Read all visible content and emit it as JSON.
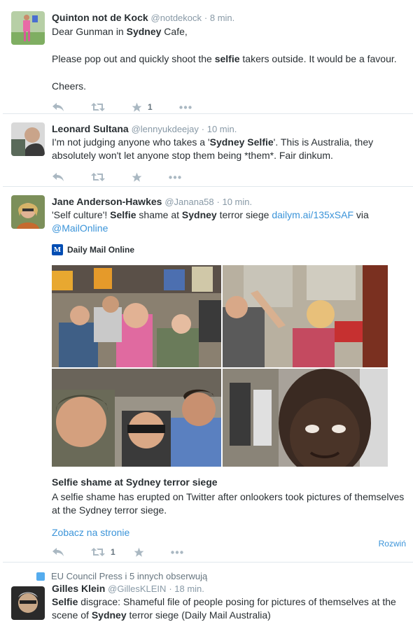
{
  "tweets": [
    {
      "fullname": "Quinton not de Kock",
      "handle": "@notdekock",
      "time": "· 8 min.",
      "p1_a": "Dear Gunman in ",
      "p1_b": "Sydney",
      "p1_c": " Cafe,",
      "p2_a": "Please pop out and quickly shoot the ",
      "p2_b": "selfie",
      "p2_c": " takers outside. It would be a favour.",
      "p3": "Cheers.",
      "fav_count": "1"
    },
    {
      "fullname": "Leonard Sultana",
      "handle": "@lennyukdeejay",
      "time": "· 10 min.",
      "t_a": "I'm not judging anyone who takes a '",
      "t_b": "Sydney Selfie",
      "t_c": "'. This is Australia, they absolutely won't let anyone stop them being *them*. Fair dinkum."
    },
    {
      "fullname": "Jane Anderson-Hawkes",
      "handle": "@Janana58",
      "time": "· 10 min.",
      "t_a": "'Self culture'! ",
      "t_b": "Selfie",
      "t_c": " shame at ",
      "t_d": "Sydney",
      "t_e": " terror siege ",
      "t_link": "dailym.ai/135xSAF",
      "t_via": " via",
      "t_mention": "@MailOnline",
      "card_logo": "M",
      "card_source": "Daily Mail Online",
      "card_title": "Selfie shame at Sydney terror siege",
      "card_desc": "A selfie shame has erupted on Twitter after onlookers took pictures of themselves at the Sydney terror siege.",
      "view_on": "Zobacz na stronie",
      "retweet_count": "1",
      "expand": "Rozwiń"
    },
    {
      "context": "EU Council Press i 5 innych obserwują",
      "fullname": "Gilles Klein",
      "handle": "@GillesKLEIN",
      "time": "· 18 min.",
      "l1_a": "Selfie",
      "l1_b": " disgrace: Shameful file of people posing for pictures of themselves at the",
      "l2_a": "scene of ",
      "l2_b": "Sydney",
      "l2_c": " terror siege (Daily Mail Australia)"
    }
  ],
  "colors": {
    "link": "#3b94d9",
    "muted": "#8899a6",
    "action_icon": "#aab8c2",
    "divider": "#e1e8ed"
  },
  "icons": [
    "reply-icon",
    "retweet-icon",
    "favorite-icon",
    "more-icon",
    "follow-context-icon",
    "daily-mail-logo"
  ]
}
